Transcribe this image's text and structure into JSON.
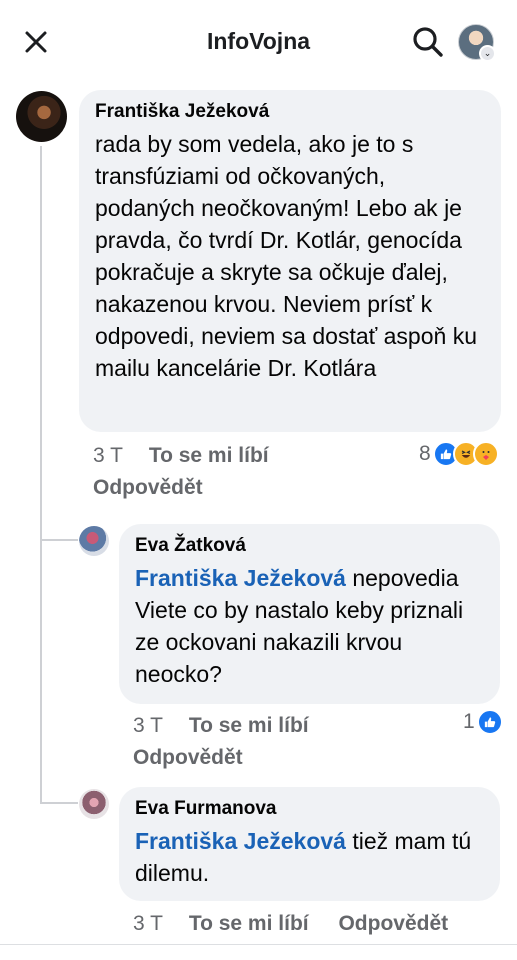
{
  "header": {
    "title": "InfoVojna",
    "close_icon": "close-icon",
    "search_icon": "search-icon",
    "profile_icon": "profile-avatar",
    "profile_badge": "⌄"
  },
  "comments": [
    {
      "author": "Františka Ježeková",
      "text": "rada by som vedela, ako je to s transfúziami od očkovaných, podaných neočkovaným! Lebo ak je pravda, čo tvrdí Dr. Kotlár, genocída pokračuje a skryte sa očkuje ďalej, nakazenou krvou. Neviem prísť k odpovedi, neviem sa dostať aspoň ku mailu kancelárie Dr. Kotlára",
      "time": "3 T",
      "like_label": "To se mi líbí",
      "reply_label": "Odpovědět",
      "reaction_count": "8",
      "reactions": [
        "like",
        "haha",
        "care"
      ]
    },
    {
      "author": "Eva Žatková",
      "mention": "Františka Ježeková",
      "text": " nepovedia Viete co by nastalo keby priznali ze ockovani nakazili krvou neocko?",
      "time": "3 T",
      "like_label": "To se mi líbí",
      "reply_label": "Odpovědět",
      "reaction_count": "1",
      "reactions": [
        "like"
      ]
    },
    {
      "author": "Eva Furmanova",
      "mention": "Františka Ježeková",
      "text": " tiež mam tú dilemu.",
      "time": "3 T",
      "like_label": "To se mi líbí",
      "reply_label": "Odpovědět"
    }
  ],
  "colors": {
    "mention": "#1a62b6",
    "bubble": "#f0f2f5",
    "meta": "#65676b",
    "like_reaction": "#1877f2"
  }
}
